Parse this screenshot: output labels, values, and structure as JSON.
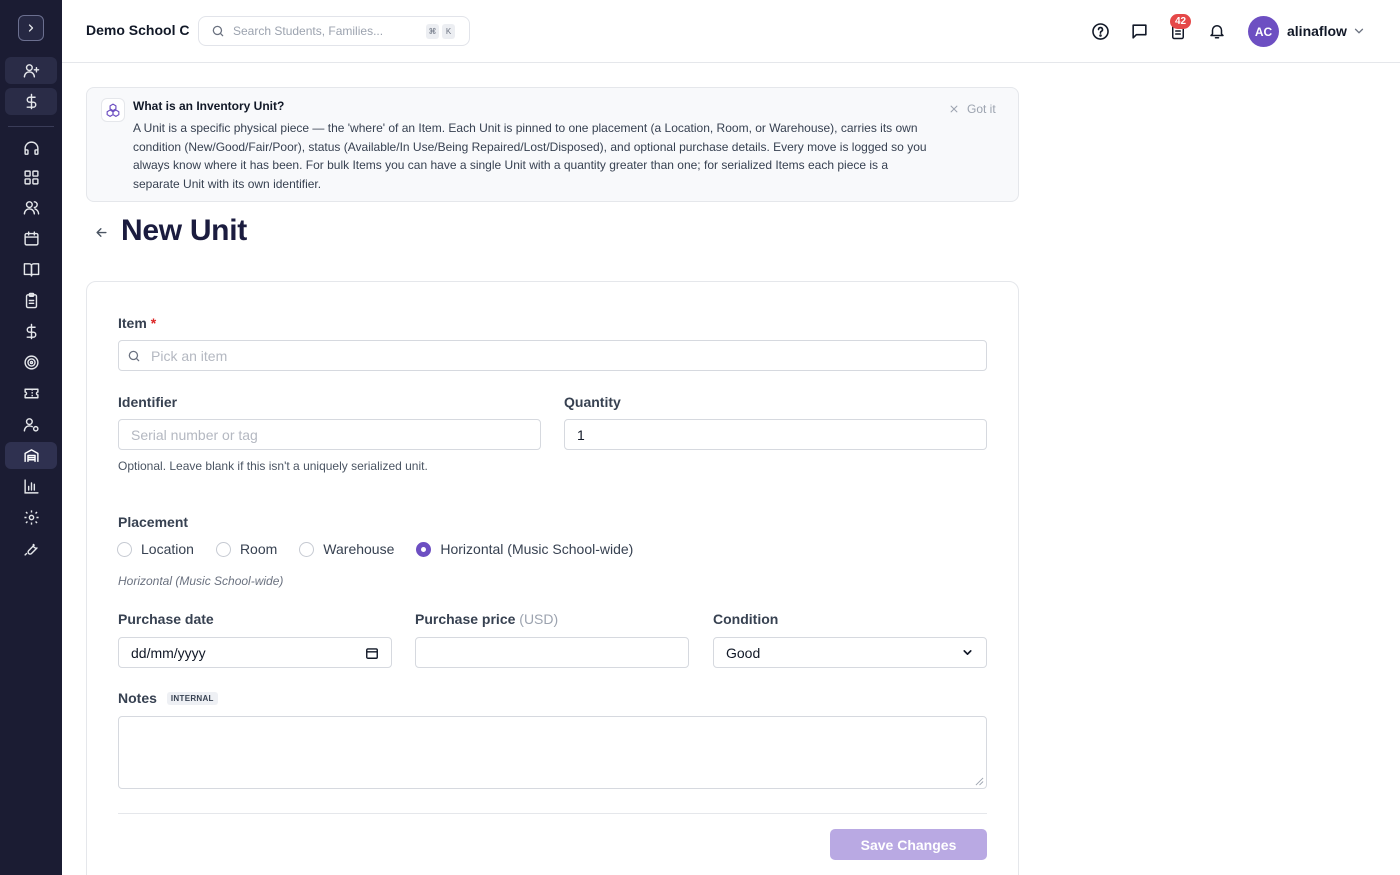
{
  "header": {
    "school_name": "Demo School C",
    "search_placeholder": "Search Students, Families...",
    "shortcut_keys": [
      "⌘",
      "K"
    ],
    "notification_count": "42",
    "user_initials": "AC",
    "username": "alinaflow"
  },
  "sidebar": {
    "items": [
      {
        "icon": "user-plus-icon"
      },
      {
        "icon": "dollar-icon"
      },
      {
        "icon": "headset-icon"
      },
      {
        "icon": "dashboard-icon"
      },
      {
        "icon": "users-icon"
      },
      {
        "icon": "calendar-icon"
      },
      {
        "icon": "book-icon"
      },
      {
        "icon": "clipboard-icon"
      },
      {
        "icon": "dollar-icon"
      },
      {
        "icon": "target-icon"
      },
      {
        "icon": "ticket-icon"
      },
      {
        "icon": "user-gear-icon"
      },
      {
        "icon": "warehouse-icon"
      },
      {
        "icon": "bar-chart-icon"
      },
      {
        "icon": "gear-icon"
      },
      {
        "icon": "wrench-icon"
      }
    ]
  },
  "banner": {
    "title": "What is an Inventory Unit?",
    "text": "A Unit is a specific physical piece — the 'where' of an Item. Each Unit is pinned to one placement (a Location, Room, or Warehouse), carries its own condition (New/Good/Fair/Poor), status (Available/In Use/Being Repaired/Lost/Disposed), and optional purchase details. Every move is logged so you always know where it has been. For bulk Items you can have a single Unit with a quantity greater than one; for serialized Items each piece is a separate Unit with its own identifier.",
    "dismiss_label": "Got it"
  },
  "page": {
    "title": "New Unit"
  },
  "form": {
    "item": {
      "label": "Item",
      "required_mark": "*",
      "placeholder": "Pick an item"
    },
    "identifier": {
      "label": "Identifier",
      "placeholder": "Serial number or tag",
      "help": "Optional. Leave blank if this isn't a uniquely serialized unit."
    },
    "quantity": {
      "label": "Quantity",
      "value": "1"
    },
    "placement": {
      "label": "Placement",
      "options": [
        "Location",
        "Room",
        "Warehouse",
        "Horizontal (Music School-wide)"
      ],
      "selected": "Horizontal (Music School-wide)",
      "note": "Horizontal (Music School-wide)"
    },
    "purchase_date": {
      "label": "Purchase date",
      "placeholder": "dd/mm/yyyy"
    },
    "purchase_price": {
      "label": "Purchase price",
      "unit": "(USD)",
      "value": ""
    },
    "condition": {
      "label": "Condition",
      "value": "Good"
    },
    "notes": {
      "label": "Notes",
      "tag": "INTERNAL",
      "value": ""
    },
    "save_label": "Save Changes"
  },
  "colors": {
    "sidebar_bg": "#1b1c33",
    "accent": "#6d4fc2",
    "save_button": "#b9a9e3",
    "badge": "#e54848"
  }
}
